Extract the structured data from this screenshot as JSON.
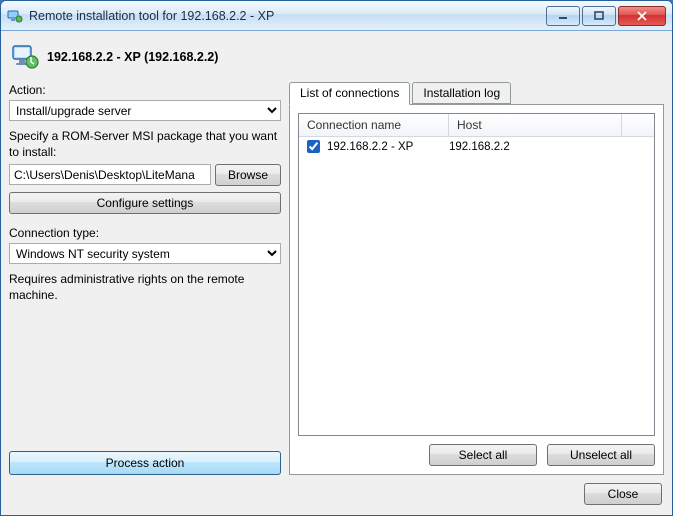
{
  "window": {
    "title": "Remote installation tool for 192.168.2.2 - XP"
  },
  "header": {
    "title": "192.168.2.2 - XP (192.168.2.2)"
  },
  "left": {
    "action_label": "Action:",
    "action_value": "Install/upgrade server",
    "msi_hint": "Specify a ROM-Server MSI package that you want to install:",
    "msi_path": "C:\\Users\\Denis\\Desktop\\LiteMana",
    "browse_label": "Browse",
    "configure_label": "Configure settings",
    "conn_type_label": "Connection type:",
    "conn_type_value": "Windows NT security system",
    "conn_type_hint": "Requires administrative rights on the remote machine.",
    "process_label": "Process action"
  },
  "tabs": {
    "connections_label": "List of connections",
    "log_label": "Installation log"
  },
  "list": {
    "col_name": "Connection name",
    "col_host": "Host",
    "rows": [
      {
        "checked": true,
        "name": "192.168.2.2 - XP",
        "host": "192.168.2.2"
      }
    ],
    "select_all": "Select all",
    "unselect_all": "Unselect all"
  },
  "footer": {
    "close_label": "Close"
  }
}
